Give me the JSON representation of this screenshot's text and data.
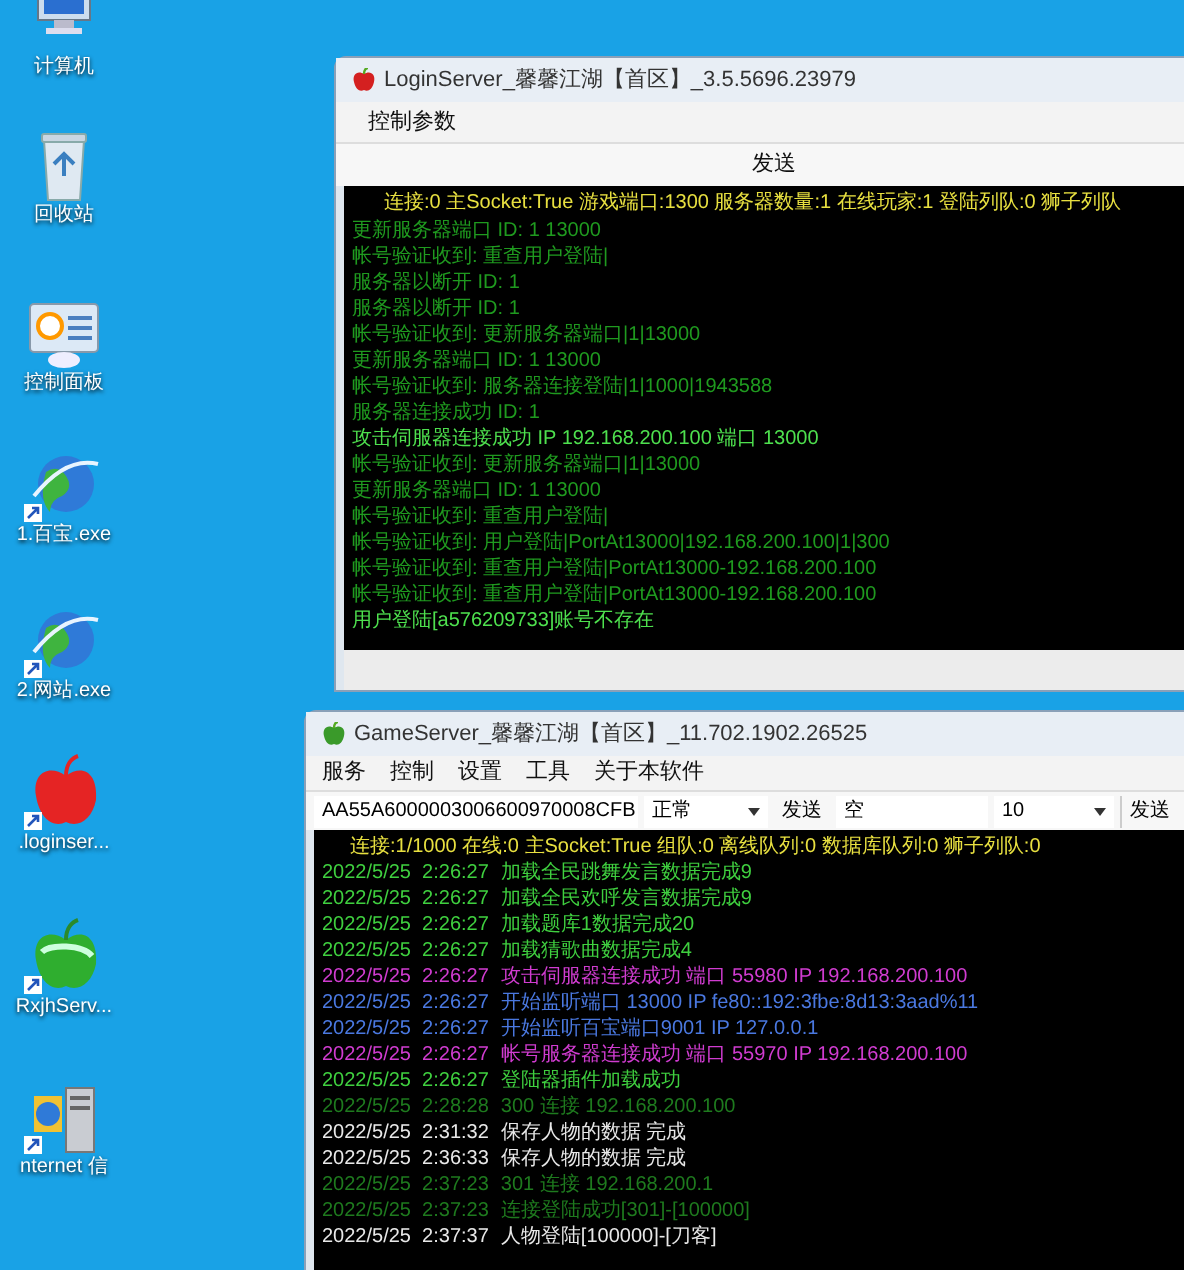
{
  "desktop_icons": [
    {
      "kind": "computer",
      "label": "计算机"
    },
    {
      "kind": "recycle",
      "label": "回收站"
    },
    {
      "kind": "panel",
      "label": "控制面板"
    },
    {
      "kind": "globe",
      "label": "1.百宝.exe"
    },
    {
      "kind": "globe",
      "label": "2.网站.exe"
    },
    {
      "kind": "red_apple",
      "label": ".loginser..."
    },
    {
      "kind": "green_apple",
      "label": "RxjhServ..."
    },
    {
      "kind": "server",
      "label": "nternet 信"
    }
  ],
  "login_window": {
    "title": "LoginServer_馨馨江湖【首区】_3.5.5696.23979",
    "menu": [
      "控制参数"
    ],
    "send_button": "发送",
    "header": "连接:0 主Socket:True 游戏端口:1300 服务器数量:1 在线玩家:1 登陆列队:0 狮子列队",
    "lines": [
      {
        "text": "更新服务器端口 ID: 1   13000",
        "color": "#1f9a1f"
      },
      {
        "text": "帐号验证收到: 重查用户登陆|",
        "color": "#1f9a1f"
      },
      {
        "text": "服务器以断开 ID: 1",
        "color": "#1f9a1f"
      },
      {
        "text": "服务器以断开 ID: 1",
        "color": "#1f9a1f"
      },
      {
        "text": "帐号验证收到: 更新服务器端口|1|13000",
        "color": "#1f9a1f"
      },
      {
        "text": "更新服务器端口 ID: 1   13000",
        "color": "#1f9a1f"
      },
      {
        "text": "帐号验证收到: 服务器连接登陆|1|1000|1943588",
        "color": "#1f9a1f"
      },
      {
        "text": "服务器连接成功 ID: 1",
        "color": "#1f9a1f"
      },
      {
        "text": "攻击伺服器连接成功 IP 192.168.200.100 端口 13000",
        "color": "#4ee04e"
      },
      {
        "text": "帐号验证收到: 更新服务器端口|1|13000",
        "color": "#1f9a1f"
      },
      {
        "text": "更新服务器端口 ID: 1   13000",
        "color": "#1f9a1f"
      },
      {
        "text": "帐号验证收到: 重查用户登陆|",
        "color": "#1f9a1f"
      },
      {
        "text": "帐号验证收到: 用户登陆|PortAt13000|192.168.200.100|1|300",
        "color": "#1f9a1f"
      },
      {
        "text": "帐号验证收到: 重查用户登陆|PortAt13000-192.168.200.100",
        "color": "#1f9a1f"
      },
      {
        "text": "帐号验证收到: 重查用户登陆|PortAt13000-192.168.200.100",
        "color": "#1f9a1f"
      },
      {
        "text": "用户登陆[a576209733]账号不存在",
        "color": "#4ee04e"
      }
    ]
  },
  "game_window": {
    "title": "GameServer_馨馨江湖【首区】_11.702.1902.26525",
    "menu": [
      "服务",
      "控制",
      "设置",
      "工具",
      "关于本软件"
    ],
    "toolbar": {
      "packet_value": "AA55A6000003006600970008CFB",
      "mode": "正常",
      "send_button": "发送",
      "target_value": "空",
      "count": "10",
      "send_button_2": "发送"
    },
    "header": "连接:1/1000 在线:0 主Socket:True 组队:0 离线队列:0 数据库队列:0 狮子列队:0",
    "lines": [
      {
        "time": "2022/5/25  2:26:27",
        "text": "加载全民跳舞发言数据完成9",
        "color": "#3fcf3f"
      },
      {
        "time": "2022/5/25  2:26:27",
        "text": "加载全民欢呼发言数据完成9",
        "color": "#3fcf3f"
      },
      {
        "time": "2022/5/25  2:26:27",
        "text": "加载题库1数据完成20",
        "color": "#3fcf3f"
      },
      {
        "time": "2022/5/25  2:26:27",
        "text": "加载猜歌曲数据完成4",
        "color": "#3fcf3f"
      },
      {
        "time": "2022/5/25  2:26:27",
        "text": "攻击伺服器连接成功 端口 55980 IP 192.168.200.100",
        "color": "#d03cd0"
      },
      {
        "time": "2022/5/25  2:26:27",
        "text": "开始监听端口 13000 IP fe80::192:3fbe:8d13:3aad%11",
        "color": "#4a78e0"
      },
      {
        "time": "2022/5/25  2:26:27",
        "text": "开始监听百宝端口9001 IP 127.0.0.1",
        "color": "#4a78e0"
      },
      {
        "time": "2022/5/25  2:26:27",
        "text": "帐号服务器连接成功 端口 55970 IP 192.168.200.100",
        "color": "#d03cd0"
      },
      {
        "time": "2022/5/25  2:26:27",
        "text": "登陆器插件加载成功",
        "color": "#3fcf3f"
      },
      {
        "time": "2022/5/25  2:28:28",
        "text": "300 连接 192.168.200.100",
        "color": "#1e7a1e"
      },
      {
        "time": "2022/5/25  2:31:32",
        "text": "保存人物的数据 完成",
        "color": "#e8e8e8"
      },
      {
        "time": "2022/5/25  2:36:33",
        "text": "保存人物的数据 完成",
        "color": "#e8e8e8"
      },
      {
        "time": "2022/5/25  2:37:23",
        "text": "301 连接 192.168.200.1",
        "color": "#1e7a1e"
      },
      {
        "time": "2022/5/25  2:37:23",
        "text": "连接登陆成功[301]-[100000]",
        "color": "#1e7a1e"
      },
      {
        "time": "2022/5/25  2:37:37",
        "text": "人物登陆[100000]-[刀客]",
        "color": "#e8e8e8"
      }
    ]
  }
}
